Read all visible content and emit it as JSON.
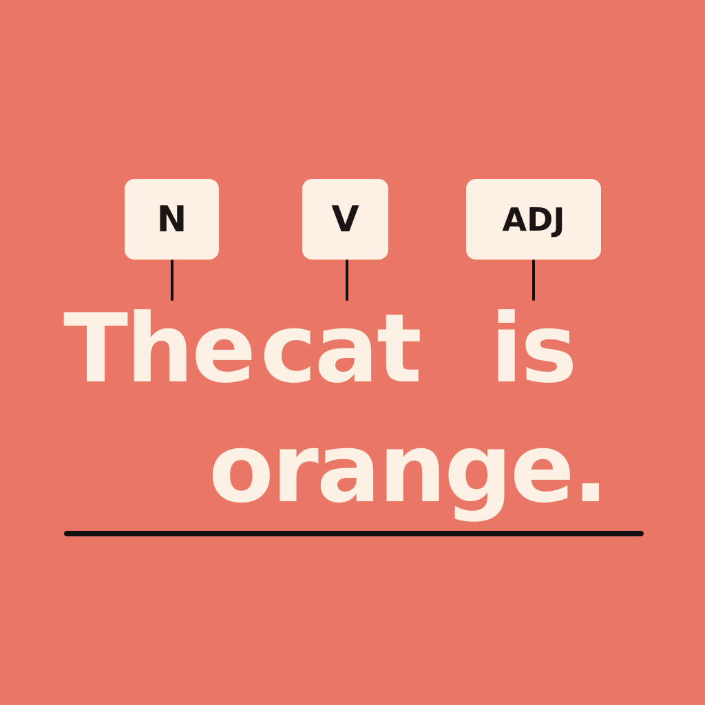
{
  "tags": {
    "noun": "N",
    "verb": "V",
    "adjective": "ADJ"
  },
  "sentence": {
    "word_1": "The",
    "word_2": "cat",
    "word_3": "is",
    "word_4": "orange."
  },
  "colors": {
    "background": "#EA7665",
    "text": "#FCF1E4",
    "tag_background": "#FCF1E4",
    "tag_text": "#1A1414",
    "line": "#141010"
  }
}
